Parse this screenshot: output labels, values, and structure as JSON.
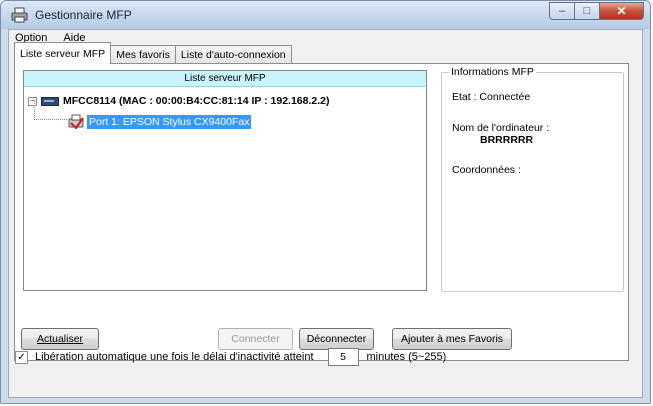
{
  "window": {
    "title": "Gestionnaire MFP",
    "minimize_glyph": "–",
    "maximize_glyph": "□",
    "close_glyph": "✕"
  },
  "menu": {
    "items": [
      {
        "label": "Option"
      },
      {
        "label": "Aide"
      }
    ]
  },
  "tabs": [
    {
      "label": "Liste serveur MFP",
      "active": true
    },
    {
      "label": "Mes favoris",
      "active": false
    },
    {
      "label": "Liste d'auto-connexion",
      "active": false
    }
  ],
  "server_list": {
    "header": "Liste serveur MFP",
    "expander_glyph": "−",
    "server_label": "MFCC8114 (MAC : 00:00:B4:CC:81:14   IP : 192.168.2.2)",
    "port_label": "Port 1: EPSON Stylus CX9400Fax"
  },
  "info": {
    "legend": "Informations MFP",
    "state": "Etat : Connectée",
    "computer_name_label": "Nom de l'ordinateur :",
    "computer_name_value": "BRRRRRR",
    "coordinates_label": "Coordonnées :"
  },
  "buttons": {
    "refresh": "Actualiser",
    "connect": "Connecter",
    "disconnect": "Déconnecter",
    "add_favorites": "Ajouter à mes Favoris"
  },
  "auto_release": {
    "checked": true,
    "check_glyph": "✓",
    "label": "Libération automatique une fois le délai d'inactivité atteint",
    "value": "5",
    "suffix": "minutes (5~255)"
  },
  "colors": {
    "list_header_bg": "#c8f5fc",
    "selection": "#3399ff",
    "close_button": "#c7503b"
  },
  "icons": {
    "app": "printer-icon",
    "server": "server-icon",
    "port": "printer-icon"
  }
}
